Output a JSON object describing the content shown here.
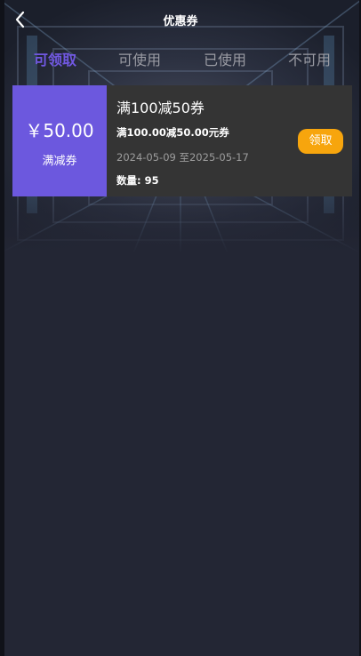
{
  "header": {
    "title": "优惠券",
    "back_icon": "chevron-left-icon"
  },
  "tabs": [
    {
      "label": "可领取",
      "active": true
    },
    {
      "label": "可使用",
      "active": false
    },
    {
      "label": "已使用",
      "active": false
    },
    {
      "label": "不可用",
      "active": false
    }
  ],
  "coupons": [
    {
      "amount": "￥50.00",
      "type": "满减券",
      "title": "满100减50券",
      "description": "满100.00减50.00元券",
      "validity": "2024-05-09 至2025-05-17",
      "quantity": "数量: 95",
      "action_label": "领取"
    }
  ],
  "colors": {
    "background": "#232634",
    "accent": "#7158e2",
    "coupon_left": "#6c58de",
    "coupon_body": "#343434",
    "claim_button": "#f7a50d"
  }
}
